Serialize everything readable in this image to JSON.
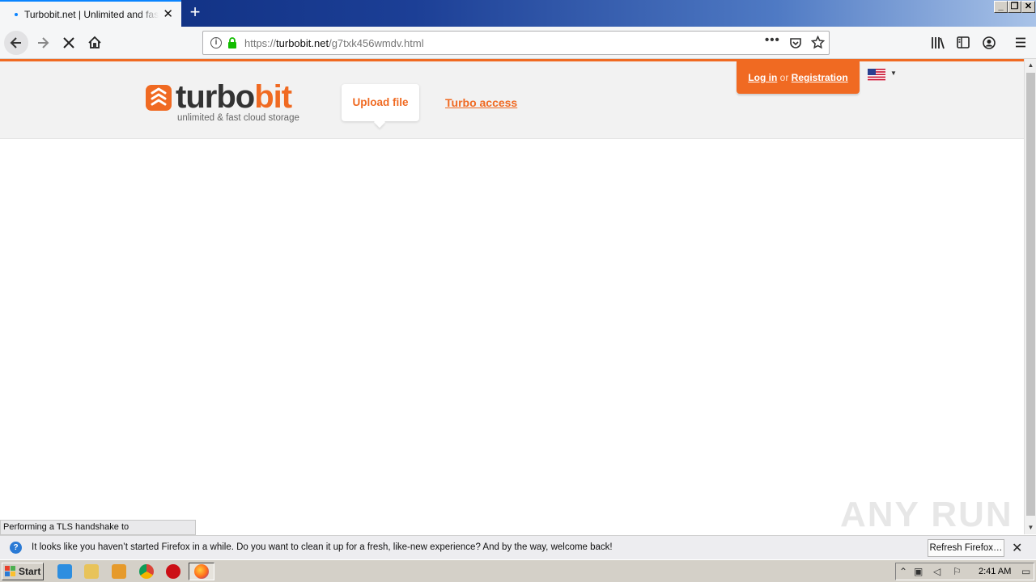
{
  "browser": {
    "tab_title": "Turbobit.net | Unlimited and fast file",
    "new_tab_label": "+",
    "url_prefix": "https://",
    "url_domain": "turbobit.net",
    "url_path": "/g7txk456wmdv.html",
    "status_text": "Performing a TLS handshake to infopicked.com...",
    "icons": [
      "back-icon",
      "forward-icon",
      "stop-icon",
      "home-icon",
      "info-icon",
      "lock-icon",
      "more-icon",
      "pocket-icon",
      "bookmark-star-icon",
      "library-icon",
      "sidebar-icon",
      "account-icon",
      "menu-icon"
    ]
  },
  "window_controls": {
    "minimize": "_",
    "restore": "❐",
    "close": "✕"
  },
  "site": {
    "logo_word_a": "turbo",
    "logo_word_b": "bit",
    "tagline": "unlimited & fast cloud storage",
    "upload_label": "Upload file",
    "turbo_label": "Turbo access",
    "login_label": "Log in",
    "or_label": "or",
    "register_label": "Registration",
    "accent_color": "#f06a22"
  },
  "notification": {
    "message": "It looks like you haven’t started Firefox in a while. Do you want to clean it up for a fresh, like-new experience? And by the way, welcome back!",
    "button_label": "Refresh Firefox…"
  },
  "watermark": "ANY RUN",
  "taskbar": {
    "start_label": "Start",
    "clock": "2:41 AM"
  }
}
